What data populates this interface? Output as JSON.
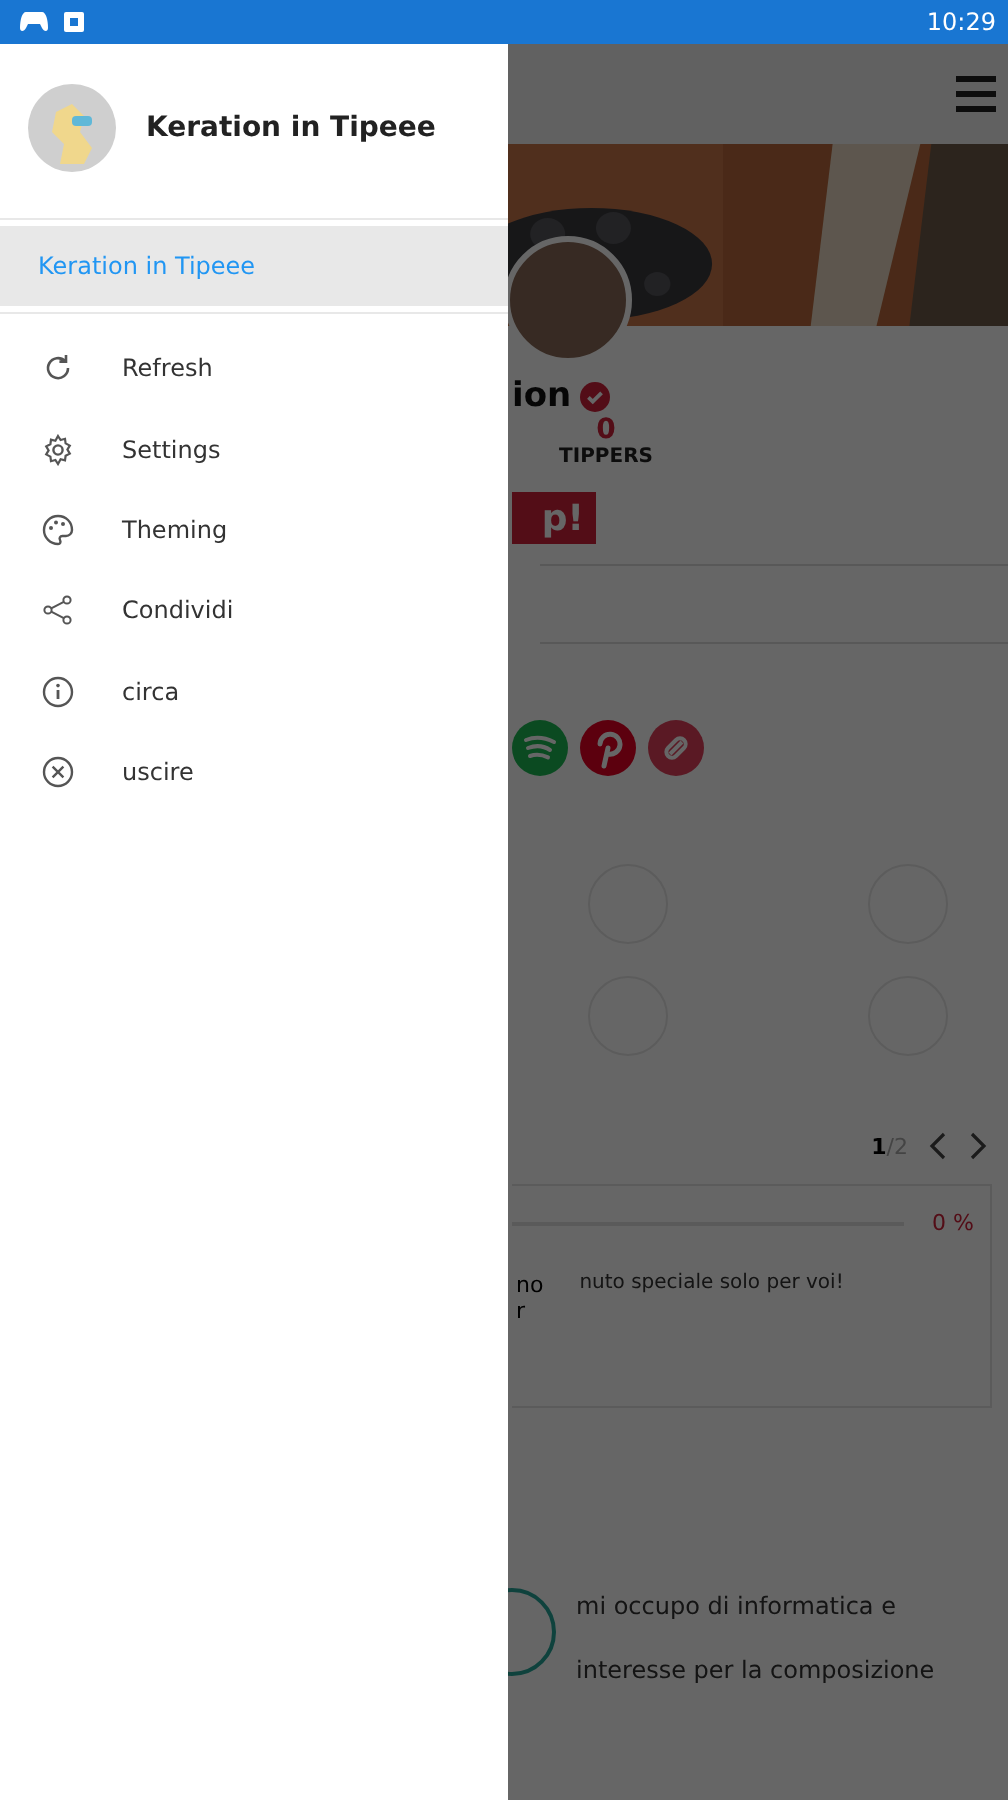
{
  "status_bar": {
    "time": "10:29"
  },
  "drawer": {
    "title": "Keration in Tipeee",
    "pages": [
      {
        "label": "Keration in Tipeee",
        "selected": true
      }
    ],
    "actions": [
      {
        "label": "Refresh",
        "kind": "refresh"
      },
      {
        "label": "Settings",
        "kind": "settings"
      },
      {
        "label": "Theming",
        "kind": "palette"
      },
      {
        "label": "Condividi",
        "kind": "share"
      },
      {
        "label": "circa",
        "kind": "info"
      },
      {
        "label": "uscire",
        "kind": "close"
      }
    ]
  },
  "background_page": {
    "name": "ion",
    "verified": true,
    "tippers_count": "0",
    "tippers_label": "TIPPERS",
    "tip_button": "p!",
    "pager": {
      "current": "1",
      "total": "/2"
    },
    "goal_percent": "0 %",
    "reward_text": "nuto speciale solo per voi!",
    "fragments": [
      "no",
      "r"
    ],
    "bio": [
      "mi occupo di informatica e",
      "interesse per la composizione"
    ]
  }
}
